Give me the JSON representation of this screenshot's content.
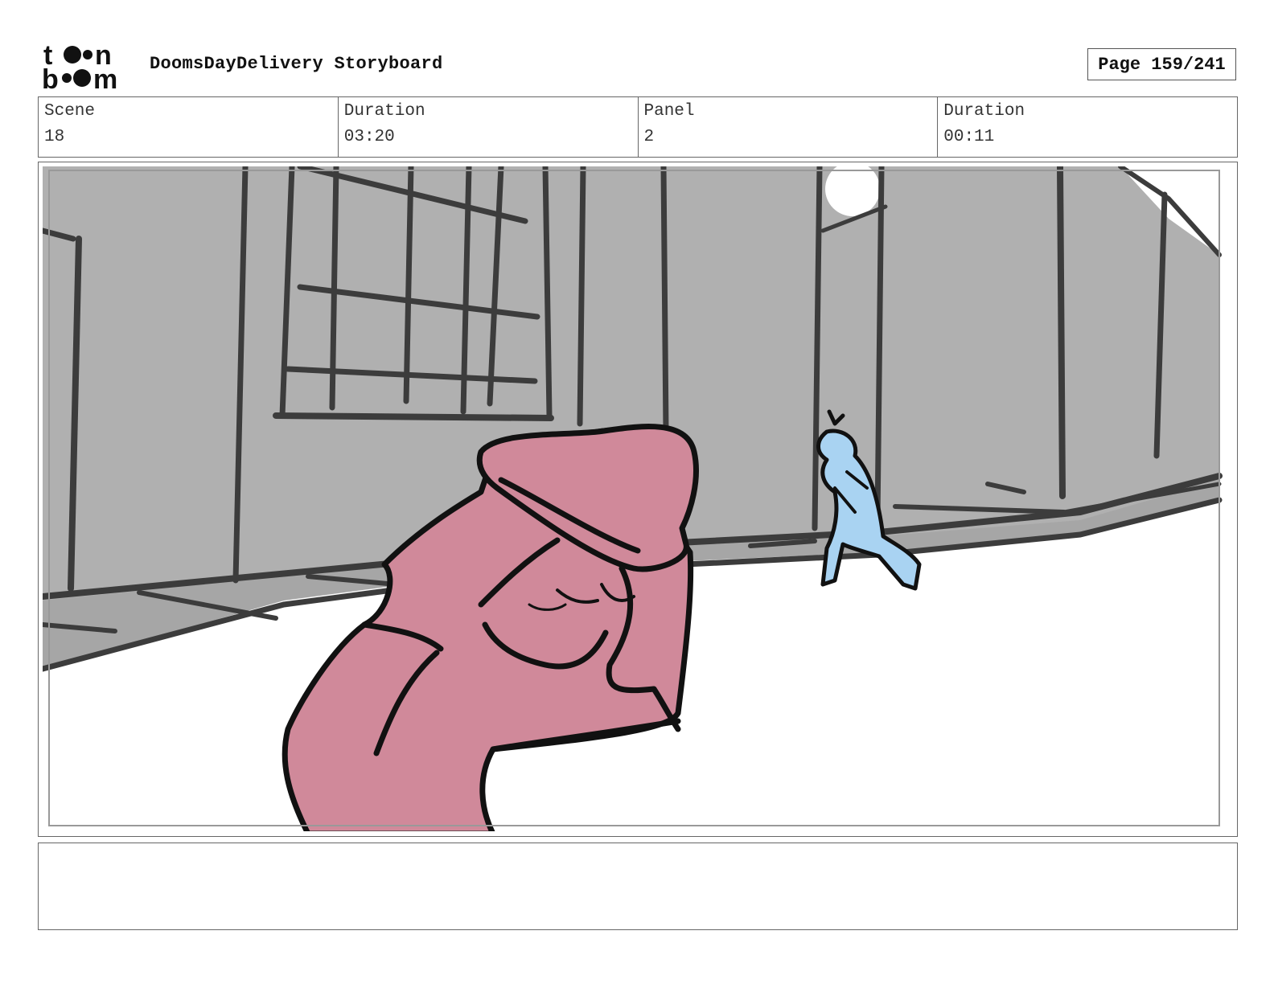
{
  "header": {
    "logo_text": "toon boom",
    "title": "DoomsDayDelivery Storyboard",
    "page": "Page 159/241"
  },
  "info": [
    {
      "label": "Scene",
      "value": "18"
    },
    {
      "label": "Duration",
      "value": "03:20"
    },
    {
      "label": "Panel",
      "value": "2"
    },
    {
      "label": "Duration",
      "value": "00:11"
    }
  ],
  "panel": {
    "colors": {
      "building": "#b0b0b0",
      "outline": "#3c3c3c",
      "foreground_character": "#d0899a",
      "background_character": "#a9d3f2",
      "ink": "#111111"
    }
  },
  "notes": ""
}
